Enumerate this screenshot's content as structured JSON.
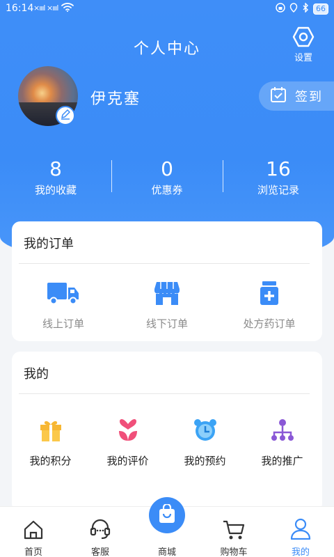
{
  "status_bar": {
    "time": "16:14",
    "signal": "×ıııl ×ıııl",
    "battery": "66"
  },
  "header": {
    "title": "个人中心",
    "settings_label": "设置"
  },
  "profile": {
    "username": "伊克塞",
    "checkin_label": "签到"
  },
  "stats": [
    {
      "value": "8",
      "label": "我的收藏"
    },
    {
      "value": "0",
      "label": "优惠券"
    },
    {
      "value": "16",
      "label": "浏览记录"
    }
  ],
  "orders": {
    "title": "我的订单",
    "items": [
      {
        "label": "线上订单",
        "icon": "truck-icon"
      },
      {
        "label": "线下订单",
        "icon": "store-icon"
      },
      {
        "label": "处方药订单",
        "icon": "medicine-bottle-icon"
      }
    ]
  },
  "mine": {
    "title": "我的",
    "items": [
      {
        "label": "我的积分",
        "icon": "gift-icon"
      },
      {
        "label": "我的评价",
        "icon": "flower-icon"
      },
      {
        "label": "我的预约",
        "icon": "alarm-clock-icon"
      },
      {
        "label": "我的推广",
        "icon": "share-tree-icon"
      }
    ]
  },
  "tabbar": {
    "items": [
      {
        "label": "首页",
        "icon": "home-icon"
      },
      {
        "label": "客服",
        "icon": "headset-icon"
      },
      {
        "label": "商城",
        "icon": "shopping-bag-icon"
      },
      {
        "label": "购物车",
        "icon": "cart-icon"
      },
      {
        "label": "我的",
        "icon": "user-icon"
      }
    ],
    "active": "我的"
  },
  "colors": {
    "primary": "#3b8cf7",
    "gift": "#f7b733",
    "flower": "#f0507a",
    "clock": "#3ba3f5",
    "share": "#8a58d6"
  }
}
